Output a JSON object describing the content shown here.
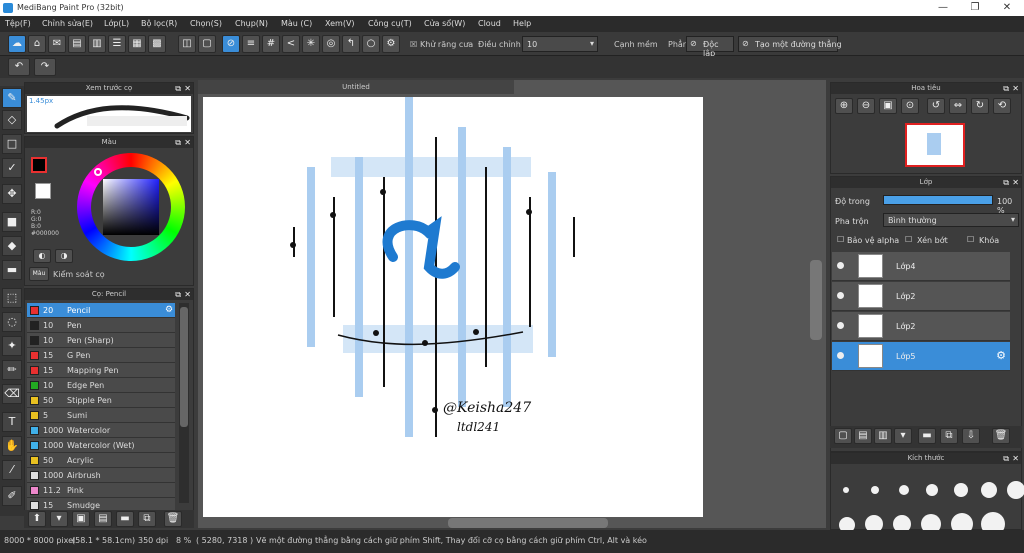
{
  "window": {
    "title": "MediBang Paint Pro (32bit)",
    "min": "—",
    "max": "❐",
    "close": "✕"
  },
  "menu": [
    "Tệp(F)",
    "Chỉnh sửa(E)",
    "Lớp(L)",
    "Bộ lọc(R)",
    "Chọn(S)",
    "Chụp(N)",
    "Màu (C)",
    "Xem(V)",
    "Công cụ(T)",
    "Cửa sổ(W)",
    "Cloud",
    "Help"
  ],
  "toolopts": {
    "antialias": "Khử răng cưa",
    "adjust_label": "Điều chỉnh",
    "adjust_value": "10",
    "edge": "Cạnh mềm",
    "snap": "Phẳng",
    "off": "Độc lập",
    "create_line": "Tạo một đường thẳng"
  },
  "brush_preview": {
    "title": "Xem trước cọ",
    "size": "1.45px"
  },
  "color_panel": {
    "title": "Màu",
    "r": "R:0",
    "g": "G:0",
    "b": "B:0",
    "hex": "#000000",
    "fg": "#000000",
    "bg": "#ffffff",
    "control": "Kiểm soát cọ",
    "color_btn": "Màu"
  },
  "brush_panel": {
    "title": "Cọ: Pencil",
    "items": [
      {
        "size": "20",
        "name": "Pencil",
        "color": "#e83030"
      },
      {
        "size": "10",
        "name": "Pen",
        "color": "#222222"
      },
      {
        "size": "10",
        "name": "Pen (Sharp)",
        "color": "#222222"
      },
      {
        "size": "15",
        "name": "G Pen",
        "color": "#e83030"
      },
      {
        "size": "15",
        "name": "Mapping Pen",
        "color": "#e83030"
      },
      {
        "size": "10",
        "name": "Edge Pen",
        "color": "#22aa22"
      },
      {
        "size": "50",
        "name": "Stipple Pen",
        "color": "#e8c020"
      },
      {
        "size": "5",
        "name": "Sumi",
        "color": "#e8c020"
      },
      {
        "size": "1000",
        "name": "Watercolor",
        "color": "#40b0e8"
      },
      {
        "size": "1000",
        "name": "Watercolor (Wet)",
        "color": "#40b0e8"
      },
      {
        "size": "50",
        "name": "Acrylic",
        "color": "#e8c020"
      },
      {
        "size": "1000",
        "name": "Airbrush",
        "color": "#dddddd"
      },
      {
        "size": "11.2",
        "name": "Pink",
        "color": "#ee88cc"
      },
      {
        "size": "15",
        "name": "Smudge",
        "color": "#dddddd"
      }
    ]
  },
  "canvas": {
    "tab": "Untitled",
    "signature": "@Keisha247",
    "signature2": "ltdl241"
  },
  "navigator": {
    "title": "Hoa tiêu"
  },
  "layer_panel": {
    "title": "Lớp",
    "opacity_label": "Độ trong",
    "opacity_value": "100 %",
    "opacity_level": 1.0,
    "blend_label": "Pha trộn",
    "blend_value": "Bình thường",
    "protect_alpha": "Bảo vệ alpha",
    "clip": "Xén bớt",
    "lock": "Khóa",
    "layers": [
      {
        "name": "Lớp4",
        "selected": false
      },
      {
        "name": "Lớp2",
        "selected": false
      },
      {
        "name": "Lớp2",
        "selected": false
      },
      {
        "name": "Lớp5",
        "selected": true
      }
    ]
  },
  "brush_size_panel": {
    "title": "Kích thước",
    "sizes_row1": [
      "1",
      "1.5",
      "2",
      "3",
      "5",
      "7",
      "10"
    ],
    "sizes_row2": [
      "7",
      "10",
      "12",
      "15",
      "20",
      "25"
    ]
  },
  "status": {
    "size": "8000 * 8000 pixel",
    "cm": "(58.1 * 58.1cm)",
    "dpi": "350 dpi",
    "zoom": "8 %",
    "coords": "( 5280, 7318 )",
    "hint": "Vẽ một đường thẳng bằng cách giữ phím Shift, Thay đổi cỡ cọ bằng cách giữ phím Ctrl, Alt và kéo"
  }
}
